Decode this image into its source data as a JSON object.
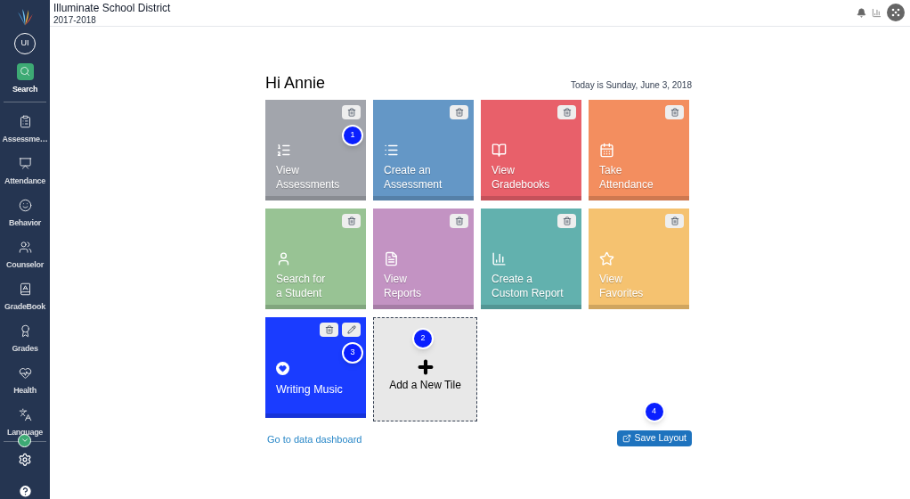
{
  "sidebar": {
    "avatar": "UI",
    "items": [
      {
        "label": "Search",
        "selected": true
      },
      {
        "label": "Assessme…",
        "selected": false
      },
      {
        "label": "Attendance",
        "selected": false
      },
      {
        "label": "Behavior",
        "selected": false
      },
      {
        "label": "Counselor",
        "selected": false
      },
      {
        "label": "GradeBook",
        "selected": false
      },
      {
        "label": "Grades",
        "selected": false
      },
      {
        "label": "Health",
        "selected": false
      },
      {
        "label": "Language",
        "selected": false
      }
    ]
  },
  "header": {
    "district": "Illuminate School District",
    "year": "2017-2018"
  },
  "greeting": "Hi Annie",
  "date": "Today is Sunday, June 3, 2018",
  "tiles": [
    {
      "kind": "standard",
      "lines": [
        "View",
        "Assessments"
      ],
      "color": "#a2a5ac",
      "marker": "1"
    },
    {
      "kind": "standard",
      "lines": [
        "Create an",
        "Assessment"
      ],
      "color": "#6497c6"
    },
    {
      "kind": "standard",
      "lines": [
        "View",
        "Gradebooks"
      ],
      "color": "#e8606a"
    },
    {
      "kind": "standard",
      "lines": [
        "Take",
        "Attendance"
      ],
      "color": "#f38e5f"
    },
    {
      "kind": "standard",
      "lines": [
        "Search for",
        "a Student"
      ],
      "color": "#98c394"
    },
    {
      "kind": "standard",
      "lines": [
        "View",
        "Reports"
      ],
      "color": "#c393c3"
    },
    {
      "kind": "standard",
      "lines": [
        "Create a",
        "Custom Report"
      ],
      "color": "#62b1ae"
    },
    {
      "kind": "standard",
      "lines": [
        "View",
        "Favorites"
      ],
      "color": "#f5c270"
    },
    {
      "kind": "custom",
      "lines": [
        "Writing Music"
      ],
      "color": "#1a3cff",
      "marker": "3"
    }
  ],
  "add_tile": {
    "label": "Add a New Tile",
    "marker": "2"
  },
  "dashboard_link": "Go to data dashboard",
  "save_button": {
    "label": "Save Layout",
    "marker": "4"
  }
}
